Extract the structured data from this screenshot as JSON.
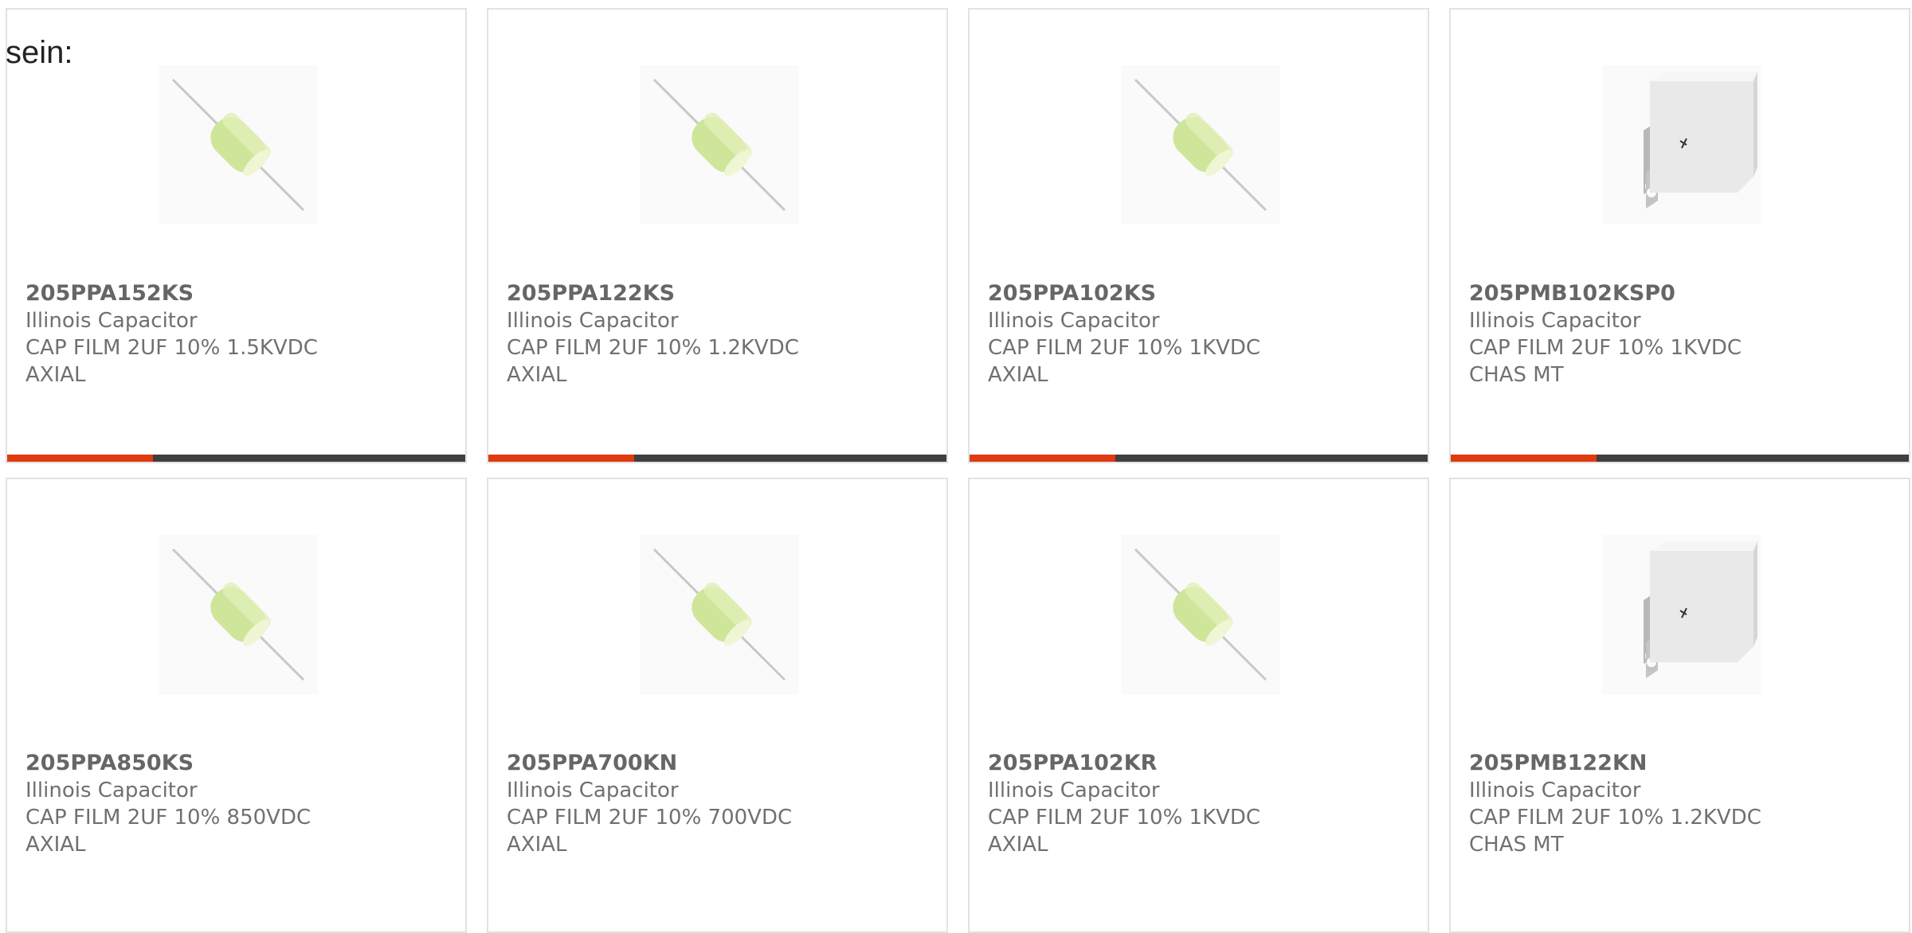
{
  "intro_text": "sein:",
  "colors": {
    "accent": "#e03a10",
    "bar": "#3f3f3f",
    "border": "#e2e2e2",
    "text": "#707070"
  },
  "products": [
    {
      "part_number": "205PPA152KS",
      "manufacturer": "Illinois Capacitor",
      "description": "CAP FILM 2UF 10% 1.5KVDC AXIAL",
      "image_icon": "axial-film-capacitor-icon"
    },
    {
      "part_number": "205PPA122KS",
      "manufacturer": "Illinois Capacitor",
      "description": "CAP FILM 2UF 10% 1.2KVDC AXIAL",
      "image_icon": "axial-film-capacitor-icon"
    },
    {
      "part_number": "205PPA102KS",
      "manufacturer": "Illinois Capacitor",
      "description": "CAP FILM 2UF 10% 1KVDC AXIAL",
      "image_icon": "axial-film-capacitor-icon"
    },
    {
      "part_number": "205PMB102KSP0",
      "manufacturer": "Illinois Capacitor",
      "description": "CAP FILM 2UF 10% 1KVDC CHAS MT",
      "image_icon": "chassis-mount-capacitor-icon"
    },
    {
      "part_number": "205PPA850KS",
      "manufacturer": "Illinois Capacitor",
      "description": "CAP FILM 2UF 10% 850VDC AXIAL",
      "image_icon": "axial-film-capacitor-icon"
    },
    {
      "part_number": "205PPA700KN",
      "manufacturer": "Illinois Capacitor",
      "description": "CAP FILM 2UF 10% 700VDC AXIAL",
      "image_icon": "axial-film-capacitor-icon"
    },
    {
      "part_number": "205PPA102KR",
      "manufacturer": "Illinois Capacitor",
      "description": "CAP FILM 2UF 10% 1KVDC AXIAL",
      "image_icon": "axial-film-capacitor-icon"
    },
    {
      "part_number": "205PMB122KN",
      "manufacturer": "Illinois Capacitor",
      "description": "CAP FILM 2UF 10% 1.2KVDC CHAS MT",
      "image_icon": "chassis-mount-capacitor-icon"
    }
  ]
}
